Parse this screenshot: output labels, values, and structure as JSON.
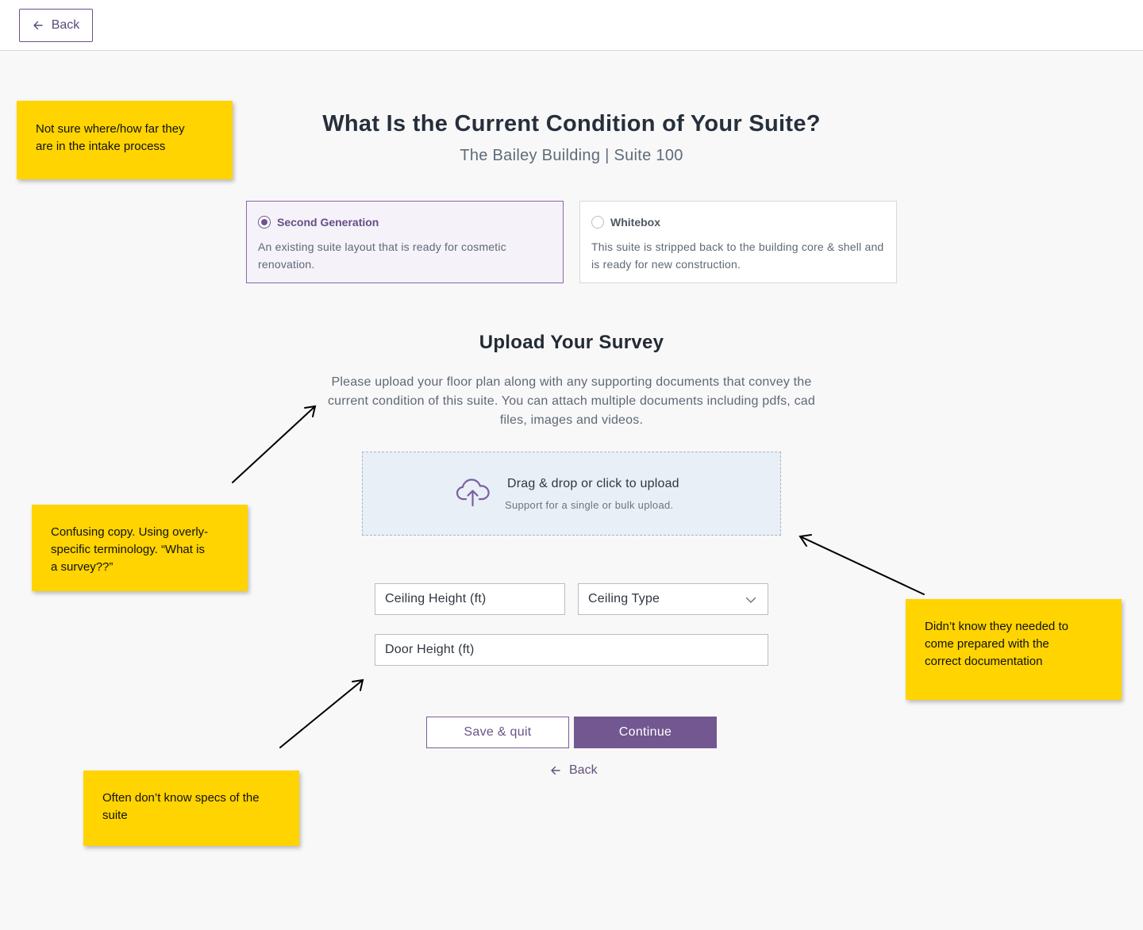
{
  "header": {
    "back_label": "Back"
  },
  "main": {
    "title": "What Is the Current Condition of Your Suite?",
    "subtitle": "The Bailey Building | Suite 100",
    "options": [
      {
        "label": "Second Generation",
        "description": "An existing suite layout that is ready for cosmetic renovation.",
        "selected": true
      },
      {
        "label": "Whitebox",
        "description": "This suite is stripped back to the building core & shell and is ready for new construction.",
        "selected": false
      }
    ],
    "upload_section": {
      "title": "Upload Your Survey",
      "description": "Please upload your floor plan along with any supporting documents that convey the current condition of this suite. You can attach multiple documents including pdfs, cad files, images and videos.",
      "dropzone_title": "Drag & drop or click to upload",
      "dropzone_hint": "Support for a single or bulk upload."
    },
    "fields": {
      "ceiling_height": "Ceiling Height (ft)",
      "ceiling_type": "Ceiling Type",
      "door_height": "Door Height (ft)"
    },
    "actions": {
      "save_label": "Save & quit",
      "continue_label": "Continue",
      "back_label": "Back"
    }
  },
  "annotations": [
    {
      "line1": "Not sure where/how far they",
      "line2": "are in the intake process"
    },
    {
      "line1": "Confusing copy. Using overly-",
      "line2": "specific terminology. “What is",
      "line3": "a survey??”"
    },
    {
      "line1": "Didn’t know they needed to",
      "line2": "come prepared with the",
      "line3": "correct documentation"
    },
    {
      "line1": "Often don’t know specs of the",
      "line2": "suite"
    }
  ],
  "colors": {
    "brand_purple": "#725790",
    "selected_card_bg": "#f5f2f9",
    "dropzone_bg": "#e8eff7",
    "sticky_note": "#ffd400",
    "page_bg": "#f8f8f8"
  },
  "icons": [
    "arrow-left-icon",
    "radio-icon",
    "cloud-upload-icon",
    "chevron-down-icon"
  ]
}
